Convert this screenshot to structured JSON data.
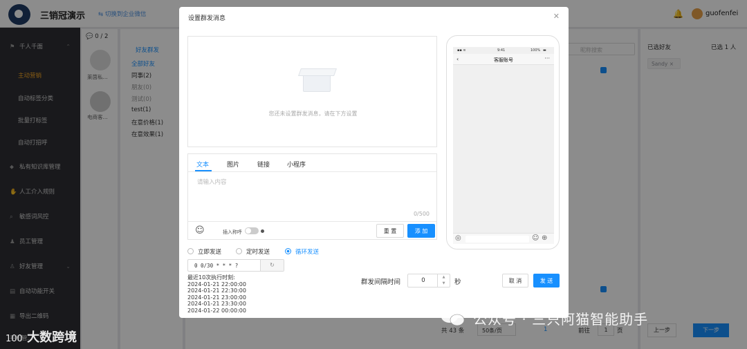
{
  "app": {
    "title": "三销冠演示",
    "switch_link": "切换到企业微信",
    "username": "guofenfei"
  },
  "sidebar": {
    "items": [
      {
        "label": "千人千面",
        "icon": "flag-icon"
      },
      {
        "label": "主动营销",
        "active": true
      },
      {
        "label": "自动标签分类"
      },
      {
        "label": "批量打标签"
      },
      {
        "label": "自动打招呼"
      },
      {
        "label": "私有知识库管理",
        "icon": "tag-icon"
      },
      {
        "label": "人工介入规则",
        "icon": "hand-icon"
      },
      {
        "label": "敏感词风控",
        "icon": "search-icon"
      },
      {
        "label": "员工管理",
        "icon": "user-icon"
      },
      {
        "label": "好友管理",
        "icon": "users-icon"
      },
      {
        "label": "自动功能开关",
        "icon": "switch-icon"
      },
      {
        "label": "导出二维码",
        "icon": "qrcode-icon"
      },
      {
        "label": "手机管..."
      }
    ]
  },
  "bg": {
    "account_count": "0 / 2",
    "accounts": [
      "莱茵私...",
      "电商客..."
    ],
    "group_tab": "好友群发",
    "groups": [
      "全部好友",
      "同事(2)",
      "朋友(0)",
      "测试(0)",
      "test(1)",
      "在意价格(1)",
      "在意效果(1)"
    ],
    "search_placeholder": "昵称搜索",
    "selected_label": "已选好友",
    "selected_count": "已选 1 人",
    "selected_tag": "Sandy",
    "total": "共 43 条",
    "page_size": "50条/页",
    "page_current": "1",
    "goto_label": "前往",
    "goto_value": "1",
    "page_unit": "页",
    "prev_btn": "上一步",
    "next_btn": "下一步"
  },
  "modal": {
    "title": "设置群发消息",
    "empty_hint": "您还未设置群发消息，请在下方设置",
    "tabs": [
      "文本",
      "图片",
      "链接",
      "小程序"
    ],
    "textarea_placeholder": "请输入内容",
    "counter": "0/500",
    "insert_label": "插入称呼",
    "reset_btn": "重 置",
    "add_btn": "添 加",
    "phone": {
      "time": "9:41",
      "battery": "100%",
      "title": "客服账号"
    },
    "send_modes": [
      "立即发送",
      "定时发送",
      "循环发送"
    ],
    "selected_mode": "循环发送",
    "cron_value": "0 0/30 * * * ?",
    "exec_title": "最近10次执行时刻:",
    "exec_times": [
      "2024-01-21 22:00:00",
      "2024-01-21 22:30:00",
      "2024-01-21 23:00:00",
      "2024-01-21 23:30:00",
      "2024-01-22 00:00:00"
    ],
    "interval_label": "群发间隔时间",
    "interval_value": "0",
    "interval_unit": "秒",
    "cancel_btn": "取 消",
    "send_btn": "发 送"
  },
  "watermark": {
    "text": "公众号 · 三只阿猫智能助手",
    "brand": "大数跨境",
    "brand_prefix": "100"
  }
}
